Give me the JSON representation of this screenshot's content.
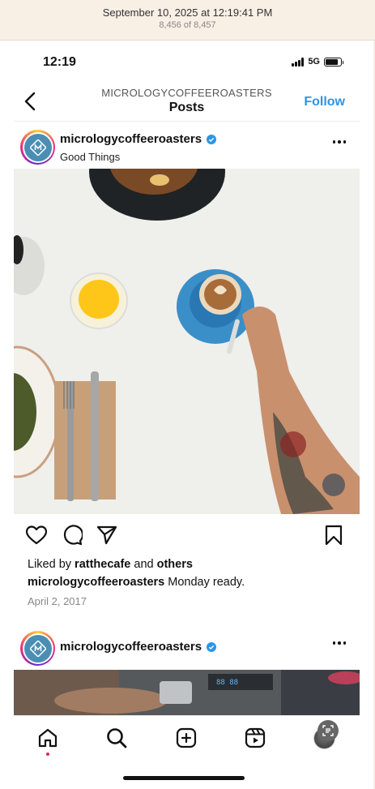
{
  "photos_viewer": {
    "date": "September 10, 2025 at 12:19:41 PM",
    "count": "8,456 of 8,457"
  },
  "status_bar": {
    "time": "12:19",
    "network": "5G"
  },
  "header": {
    "account": "MICROLOGYCOFFEEROASTERS",
    "title": "Posts",
    "follow_label": "Follow"
  },
  "post1": {
    "username": "micrologycoffeeroasters",
    "subtitle": "Good Things",
    "likes_prefix": "Liked by ",
    "liked_user": "ratthecafe",
    "likes_and": " and ",
    "likes_others": "others",
    "caption_user": "micrologycoffeeroasters",
    "caption_text": " Monday ready.",
    "date": "April 2, 2017"
  },
  "post2": {
    "username": "micrologycoffeeroasters"
  },
  "tab_bar": {
    "items": [
      "home-icon",
      "search-icon",
      "create-icon",
      "reels-icon",
      "profile-avatar"
    ]
  },
  "colors": {
    "follow": "#2c95e6",
    "verified": "#2c95e6",
    "brand_logo": "#4a8fb3"
  }
}
